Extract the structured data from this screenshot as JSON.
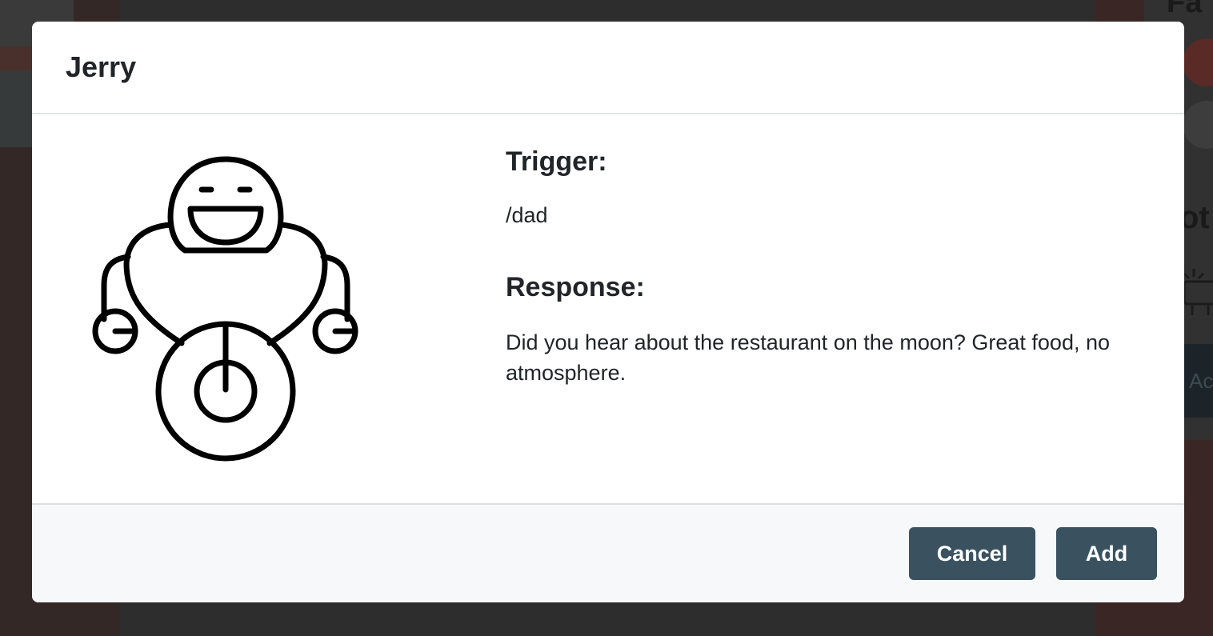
{
  "background": {
    "heading_fragment": "Fa",
    "heading2_fragment": "ot",
    "dark_button_fragment": "Ac",
    "icons": [
      "avatar",
      "avatar",
      "bot-icon"
    ]
  },
  "modal": {
    "title": "Jerry",
    "image_icon": "robot-icon",
    "trigger": {
      "label": "Trigger:",
      "value": "/dad"
    },
    "response": {
      "label": "Response:",
      "value": "Did you hear about the restaurant on the moon? Great food, no atmosphere."
    },
    "buttons": {
      "cancel": "Cancel",
      "add": "Add"
    }
  },
  "colors": {
    "button_bg": "#3a5260",
    "footer_bg": "#f7f8f9",
    "overlay_bg": "#2f2f2f"
  }
}
